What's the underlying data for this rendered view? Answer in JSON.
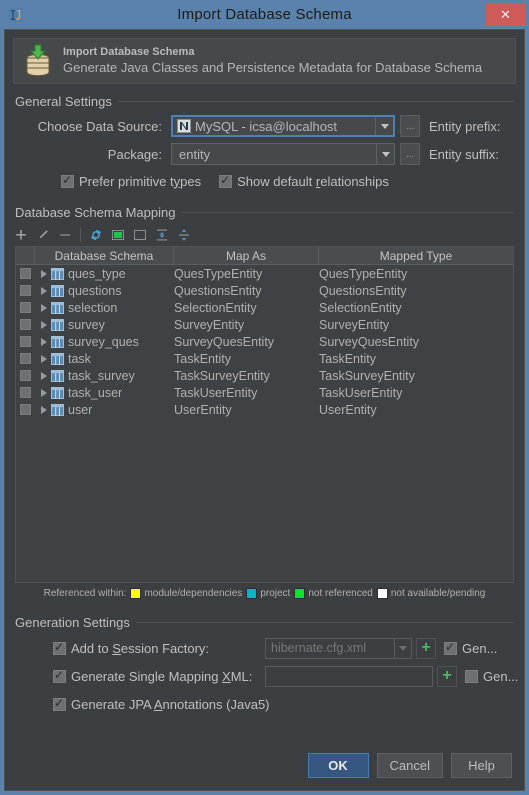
{
  "window": {
    "title": "Import Database Schema",
    "app_icon": "intellij-logo-icon",
    "close_label": "✕"
  },
  "banner": {
    "icon": "database-import-icon",
    "title": "Import Database Schema",
    "subtitle": "Generate Java Classes and Persistence Metadata for Database Schema"
  },
  "general_settings": {
    "group_label": "General Settings",
    "data_source": {
      "label": "Choose Data Source:",
      "icon": "mysql-datasource-icon",
      "value": "MySQL - icsa@localhost",
      "ellipsis_label": "...",
      "side_label": "Entity prefix:"
    },
    "package": {
      "label": "Package:",
      "value": "entity",
      "ellipsis_label": "...",
      "side_label": "Entity suffix:"
    },
    "checkboxes": [
      {
        "label_pre": "Prefer primitive t",
        "label_u": "y",
        "label_post": "pes",
        "checked": true
      },
      {
        "label_pre": "Show default ",
        "label_u": "r",
        "label_post": "elationships",
        "checked": true
      }
    ]
  },
  "schema_mapping": {
    "group_label": "Database Schema Mapping",
    "toolbar": [
      {
        "name": "add-button",
        "glyph": "+"
      },
      {
        "name": "edit-button",
        "glyph": "pencil"
      },
      {
        "name": "remove-button",
        "glyph": "−"
      },
      {
        "name": "refresh-button",
        "glyph": "refresh"
      },
      {
        "name": "select-all-button",
        "glyph": "select-all"
      },
      {
        "name": "deselect-all-button",
        "glyph": "deselect-all"
      },
      {
        "name": "expand-all-button",
        "glyph": "expand-all"
      },
      {
        "name": "collapse-all-button",
        "glyph": "collapse-all"
      }
    ],
    "columns": [
      "",
      "Database Schema",
      "Map As",
      "Mapped Type"
    ],
    "rows": [
      {
        "checked": false,
        "schema": "ques_type",
        "map_as": "QuesTypeEntity",
        "mapped_type": "QuesTypeEntity"
      },
      {
        "checked": false,
        "schema": "questions",
        "map_as": "QuestionsEntity",
        "mapped_type": "QuestionsEntity"
      },
      {
        "checked": false,
        "schema": "selection",
        "map_as": "SelectionEntity",
        "mapped_type": "SelectionEntity"
      },
      {
        "checked": false,
        "schema": "survey",
        "map_as": "SurveyEntity",
        "mapped_type": "SurveyEntity"
      },
      {
        "checked": false,
        "schema": "survey_ques",
        "map_as": "SurveyQuesEntity",
        "mapped_type": "SurveyQuesEntity"
      },
      {
        "checked": false,
        "schema": "task",
        "map_as": "TaskEntity",
        "mapped_type": "TaskEntity"
      },
      {
        "checked": false,
        "schema": "task_survey",
        "map_as": "TaskSurveyEntity",
        "mapped_type": "TaskSurveyEntity"
      },
      {
        "checked": false,
        "schema": "task_user",
        "map_as": "TaskUserEntity",
        "mapped_type": "TaskUserEntity"
      },
      {
        "checked": false,
        "schema": "user",
        "map_as": "UserEntity",
        "mapped_type": "UserEntity"
      }
    ]
  },
  "legend": {
    "prefix": "Referenced within:",
    "items": [
      {
        "color": "#ffff00",
        "label": "module/dependencies"
      },
      {
        "color": "#00b7c4",
        "label": "project"
      },
      {
        "color": "#00e821",
        "label": "not referenced"
      },
      {
        "color": "#ffffff",
        "label": "not available/pending"
      }
    ]
  },
  "generation_settings": {
    "group_label": "Generation Settings",
    "session_factory": {
      "label_pre": "Add to ",
      "label_u": "S",
      "label_post": "ession Factory:",
      "checked": true,
      "value": "hibernate.cfg.xml",
      "plus_label": "+",
      "tail_label": "Gen...",
      "tail_checked": true
    },
    "single_mapping_xml": {
      "label_pre": "Generate Single Mapping ",
      "label_u": "X",
      "label_post": "ML:",
      "checked": true,
      "value": "",
      "plus_label": "+",
      "tail_label": "Gen...",
      "tail_checked": false
    },
    "jpa_annotations": {
      "label_pre": "Generate JPA ",
      "label_u": "A",
      "label_post": "nnotations (Java5)",
      "checked": true
    }
  },
  "buttons": {
    "ok": "OK",
    "cancel": "Cancel",
    "help": "Help"
  },
  "colors": {
    "titlebar": "#5a82ab",
    "dialog_bg": "#3c3f41",
    "panel_bg": "#45494a",
    "accent_blue": "#365880",
    "close_red": "#cf5a5a",
    "text": "#bfbfbf",
    "green_plus": "#4eb85c"
  }
}
